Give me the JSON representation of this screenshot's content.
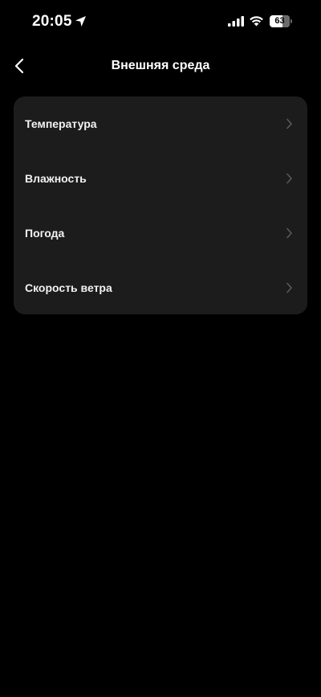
{
  "status_bar": {
    "time": "20:05",
    "battery_percent": "63",
    "battery_level": 0.63
  },
  "nav": {
    "title": "Внешняя среда",
    "back_icon": "chevron-left-icon"
  },
  "list": {
    "items": [
      {
        "label": "Температура",
        "icon": "chevron-right-icon"
      },
      {
        "label": "Влажность",
        "icon": "chevron-right-icon"
      },
      {
        "label": "Погода",
        "icon": "chevron-right-icon"
      },
      {
        "label": "Скорость ветра",
        "icon": "chevron-right-icon"
      }
    ]
  },
  "colors": {
    "background": "#000000",
    "card": "#1c1c1c",
    "text": "#ffffff",
    "chevron": "#5a5a5a"
  }
}
